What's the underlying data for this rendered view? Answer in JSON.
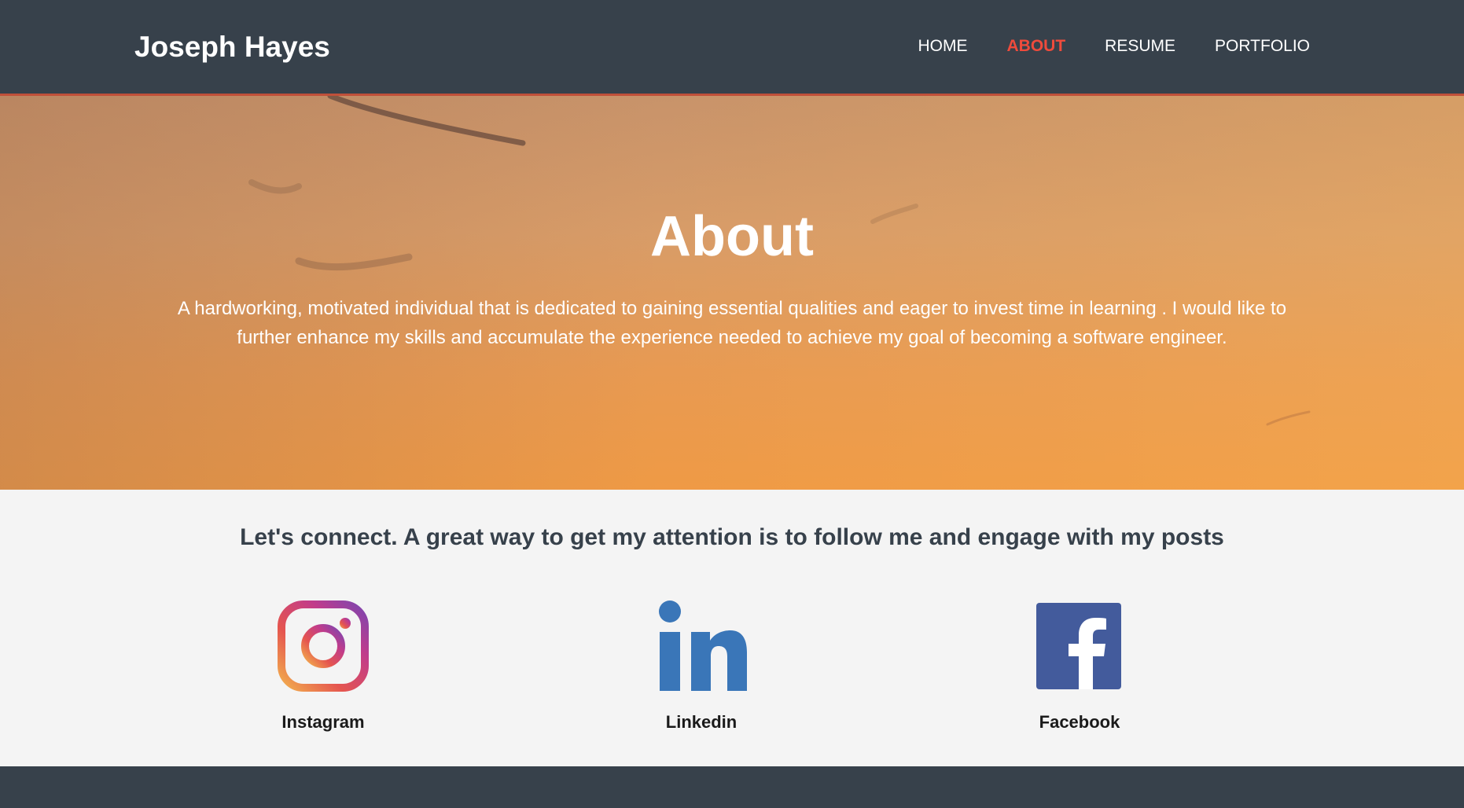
{
  "header": {
    "brand": "Joseph Hayes",
    "nav": [
      {
        "label": "HOME",
        "active": false
      },
      {
        "label": "ABOUT",
        "active": true
      },
      {
        "label": "RESUME",
        "active": false
      },
      {
        "label": "PORTFOLIO",
        "active": false
      }
    ]
  },
  "hero": {
    "title": "About",
    "text": "A hardworking, motivated individual that is dedicated to gaining essential qualities and eager to invest time in learning . I would like to further enhance my skills and accumulate the experience needed to achieve my goal of becoming a software engineer."
  },
  "connect": {
    "heading": "Let's connect. A great way to get my attention is to follow me and engage with my posts",
    "socials": [
      {
        "label": "Instagram",
        "icon": "instagram-icon"
      },
      {
        "label": "Linkedin",
        "icon": "linkedin-icon"
      },
      {
        "label": "Facebook",
        "icon": "facebook-icon"
      }
    ]
  },
  "colors": {
    "navbar": "#37414b",
    "accent": "#ef4b3c",
    "linkedin": "#3a76b8",
    "facebook": "#435b9c"
  }
}
